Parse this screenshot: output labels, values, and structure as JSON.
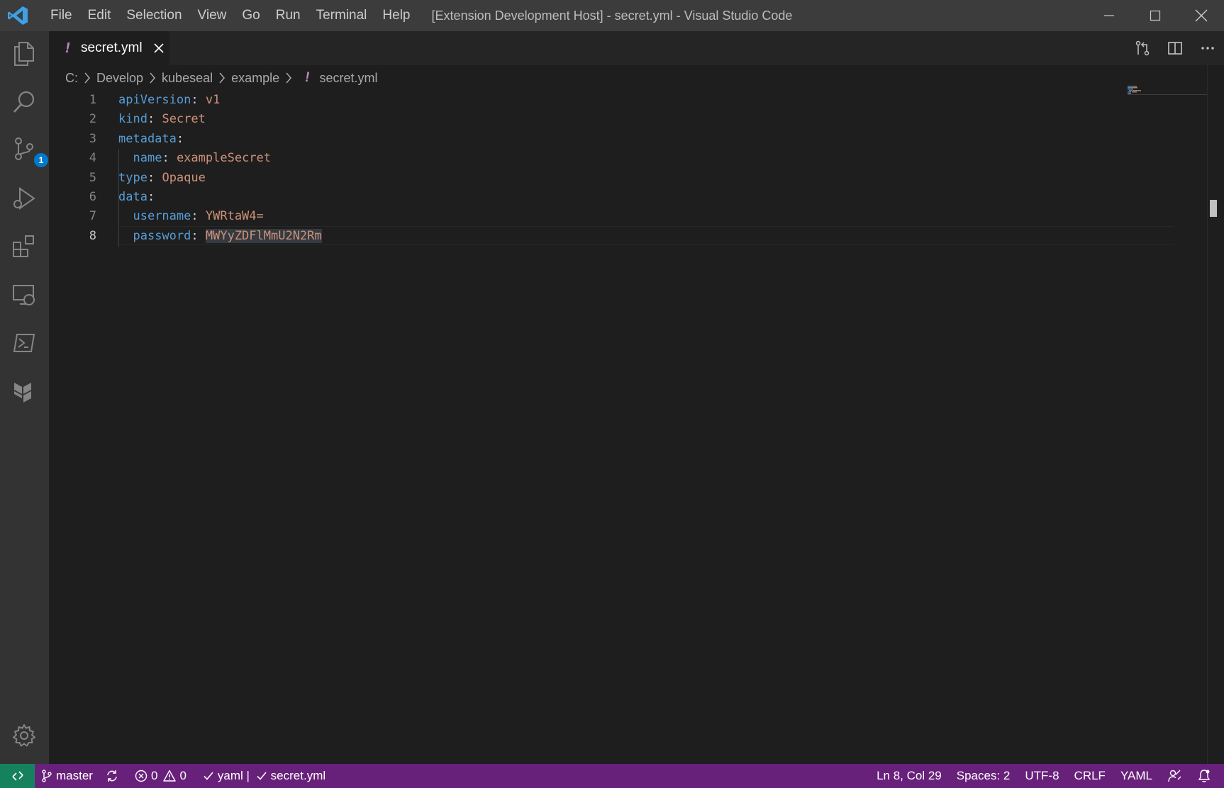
{
  "menu": [
    "File",
    "Edit",
    "Selection",
    "View",
    "Go",
    "Run",
    "Terminal",
    "Help"
  ],
  "window_title": "[Extension Development Host] - secret.yml - Visual Studio Code",
  "activity": {
    "scm_badge": "1"
  },
  "tab": {
    "icon": "!",
    "label": "secret.yml"
  },
  "breadcrumb": {
    "items": [
      "C:",
      "Develop",
      "kubeseal",
      "example"
    ],
    "file_icon": "!",
    "file": "secret.yml"
  },
  "editor": {
    "line_numbers": [
      "1",
      "2",
      "3",
      "4",
      "5",
      "6",
      "7",
      "8"
    ],
    "lines": [
      {
        "indent": "",
        "key": "apiVersion",
        "value": "v1"
      },
      {
        "indent": "",
        "key": "kind",
        "value": "Secret"
      },
      {
        "indent": "",
        "key": "metadata",
        "value": ""
      },
      {
        "indent": "  ",
        "key": "name",
        "value": "exampleSecret"
      },
      {
        "indent": "",
        "key": "type",
        "value": "Opaque"
      },
      {
        "indent": "",
        "key": "data",
        "value": ""
      },
      {
        "indent": "  ",
        "key": "username",
        "value": "YWRtaW4="
      },
      {
        "indent": "  ",
        "key": "password",
        "value": "MWYyZDFlMmU2N2Rm"
      }
    ],
    "colon": ":"
  },
  "status": {
    "branch": "master",
    "errors": "0",
    "warnings": "0",
    "yaml_check": "yaml | ",
    "file_check": "secret.yml",
    "position": "Ln 8, Col 29",
    "spaces": "Spaces: 2",
    "encoding": "UTF-8",
    "eol": "CRLF",
    "language": "YAML"
  },
  "colors": {
    "titlebar": "#3c3c3c",
    "activitybar": "#333333",
    "editor": "#1e1e1e",
    "statusbar": "#68217a",
    "remote": "#16825d",
    "keyword": "#569cd6",
    "string": "#ce9178",
    "badge": "#007acc"
  }
}
